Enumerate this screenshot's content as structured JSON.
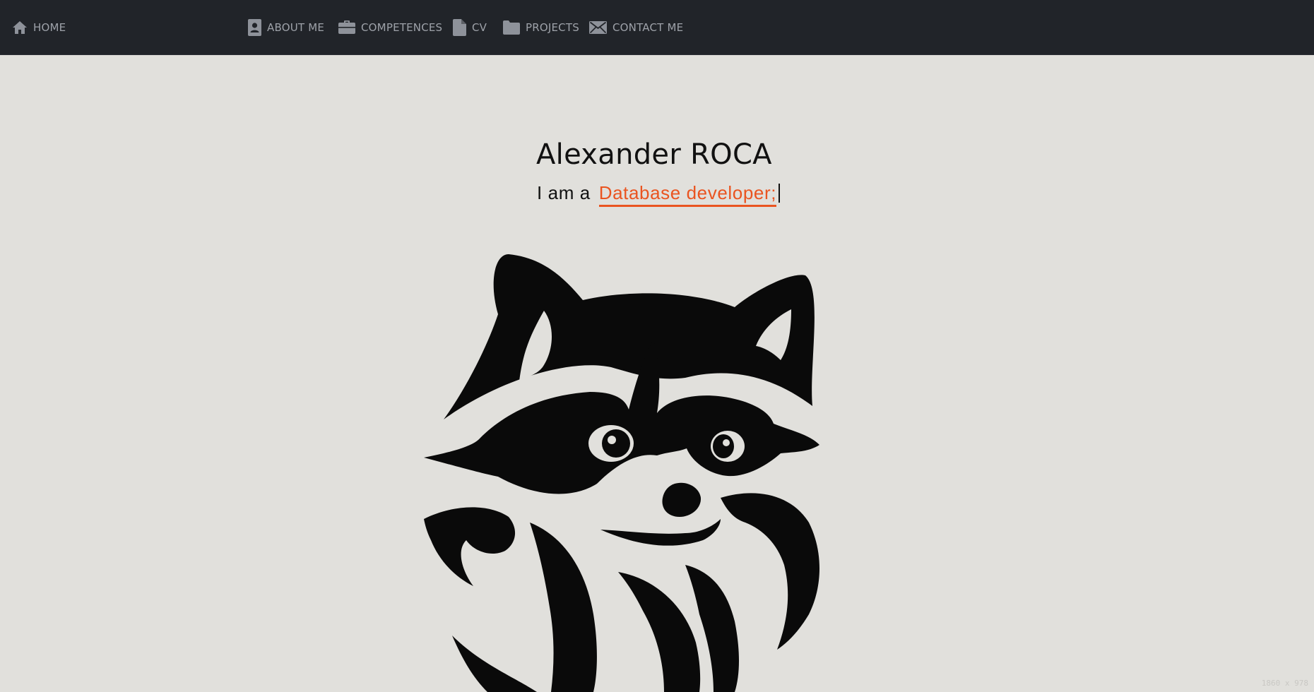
{
  "nav": {
    "home": "HOME",
    "about": "ABOUT ME",
    "competences": "COMPETENCES",
    "cv": "CV",
    "projects": "PROJECTS",
    "contact": "CONTACT ME",
    "icons": [
      "home-icon",
      "contact-card-icon",
      "briefcase-icon",
      "document-icon",
      "folder-icon",
      "envelope-icon"
    ],
    "background_color": "#212429",
    "text_color": "#9ea2a9"
  },
  "hero": {
    "name": "Alexander ROCA",
    "intro": "I am a",
    "role": "Database developer;",
    "accent_color": "#ea5420"
  },
  "mascot": {
    "icon": "raccoon-logo"
  },
  "watermark": "1860 x 978",
  "page_background": "#e1e0dc"
}
